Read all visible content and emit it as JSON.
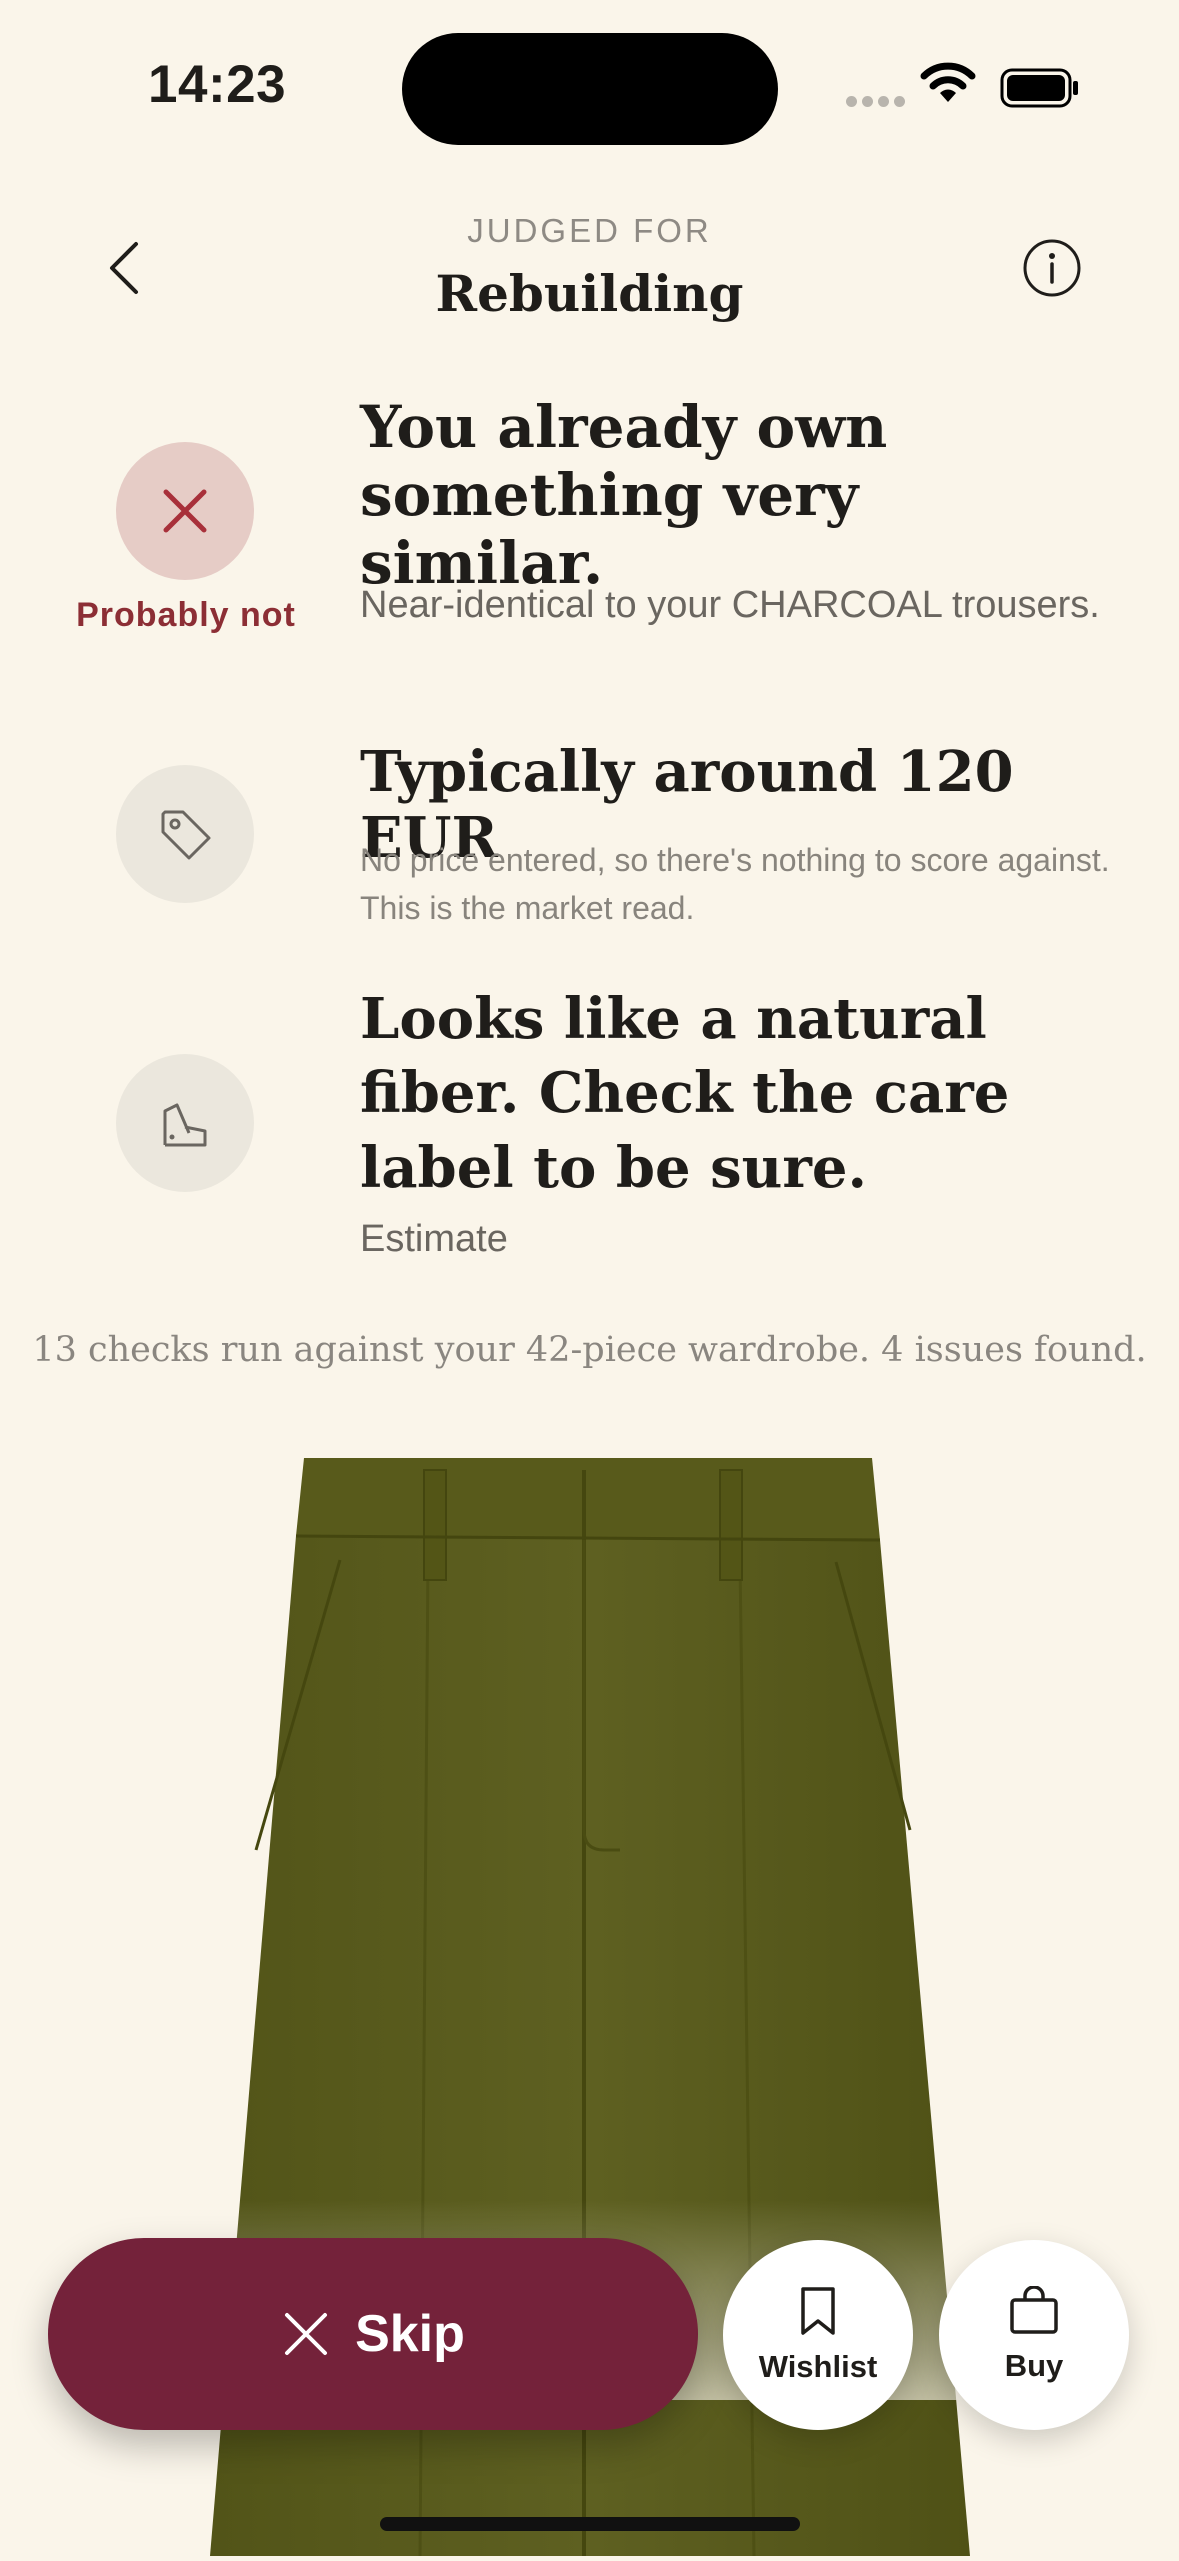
{
  "status_bar": {
    "time": "14:23"
  },
  "header": {
    "eyebrow": "JUDGED FOR",
    "title": "Rebuilding"
  },
  "verdict": {
    "label": "Probably not",
    "title": "You already own something very similar.",
    "detail": "Near-identical to your CHARCOAL trousers."
  },
  "price": {
    "title": "Typically around 120 EUR",
    "detail": "No price entered, so there's nothing to score against. This is the market read."
  },
  "fiber": {
    "title": "Looks like a natural fiber. Check the care label to be sure.",
    "detail": "Estimate"
  },
  "summary": "13 checks run against your 42-piece wardrobe. 4 issues found.",
  "actions": {
    "skip": "Skip",
    "wishlist": "Wishlist",
    "buy": "Buy"
  },
  "icons": {
    "back": "chevron-left-icon",
    "info": "info-icon",
    "verdict": "close-icon",
    "price": "tag-icon",
    "fiber": "fabric-swatch-icon",
    "skip": "close-icon",
    "wishlist": "bookmark-icon",
    "buy": "shopping-bag-icon"
  },
  "colors": {
    "background": "#faf5ea",
    "accent": "#74223a",
    "verdict_red": "#8c2e35",
    "product": "#5c5e1f"
  }
}
